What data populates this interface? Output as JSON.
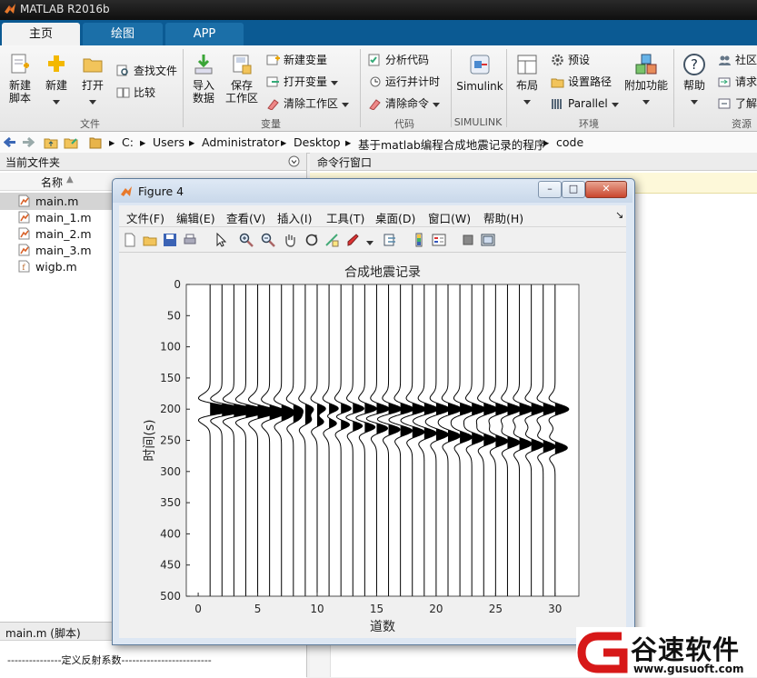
{
  "app": {
    "title": "MATLAB R2016b"
  },
  "tabs": [
    {
      "label": "主页",
      "active": true
    },
    {
      "label": "绘图",
      "active": false
    },
    {
      "label": "APP",
      "active": false
    }
  ],
  "ribbon": {
    "file": {
      "group": "文件",
      "new_script": [
        "新建",
        "脚本"
      ],
      "new": "新建",
      "open": "打开",
      "find_files": "查找文件",
      "compare": "比较"
    },
    "variable": {
      "group": "变量",
      "import": [
        "导入",
        "数据"
      ],
      "save_workspace": [
        "保存",
        "工作区"
      ],
      "new_variable": "新建变量",
      "open_variable": "打开变量",
      "clear_workspace": "清除工作区"
    },
    "code": {
      "group": "代码",
      "analyze": "分析代码",
      "run_time": "运行并计时",
      "clear_commands": "清除命令"
    },
    "simulink": {
      "group": "SIMULINK",
      "label": "Simulink"
    },
    "environment": {
      "group": "环境",
      "layout": "布局",
      "preferences": "预设",
      "set_path": "设置路径",
      "parallel": "Parallel",
      "addons": "附加功能"
    },
    "resources": {
      "group": "资源",
      "help": "帮助",
      "community": "社区",
      "request_support": "请求",
      "learn": "了解"
    }
  },
  "address": {
    "path": [
      "C:",
      "Users",
      "Administrator",
      "Desktop",
      "基于matlab编程合成地震记录的程序",
      "code"
    ]
  },
  "current_folder": {
    "title": "当前文件夹",
    "column": "名称",
    "files": [
      "main.m",
      "main_1.m",
      "main_2.m",
      "main_3.m",
      "wigb.m"
    ],
    "selected": "main.m"
  },
  "details": {
    "title": "main.m  (脚本)",
    "preview": "---------------定义反射系数-------------------------"
  },
  "command_window": {
    "title": "命令行窗口"
  },
  "figure": {
    "title": "Figure 4",
    "menu": [
      "文件(F)",
      "编辑(E)",
      "查看(V)",
      "插入(I)",
      "工具(T)",
      "桌面(D)",
      "窗口(W)",
      "帮助(H)"
    ],
    "window_buttons": {
      "minimize": "–",
      "maximize": "□",
      "close": "✕"
    }
  },
  "chart_data": {
    "type": "line",
    "title": "合成地震记录",
    "xlabel": "道数",
    "ylabel": "时间(s)",
    "xlim": [
      -1,
      32
    ],
    "ylim": [
      500,
      0
    ],
    "y_reversed": true,
    "xticks": [
      0,
      5,
      10,
      15,
      20,
      25,
      30
    ],
    "yticks": [
      0,
      50,
      100,
      150,
      200,
      250,
      300,
      350,
      400,
      450,
      500
    ],
    "traces": [
      1,
      2,
      3,
      4,
      5,
      6,
      7,
      8,
      9,
      10,
      11,
      12,
      13,
      14,
      15,
      16,
      17,
      18,
      19,
      20,
      21,
      22,
      23,
      24,
      25,
      26,
      27,
      28,
      29,
      30
    ],
    "events": [
      {
        "name": "flat",
        "time_start": 200,
        "time_end": 200
      },
      {
        "name": "dipping",
        "time_start": 200,
        "time_end": 262
      }
    ],
    "grid": false,
    "style": "wiggle-variable-area"
  },
  "watermark": {
    "brand": "谷速软件",
    "url": "www.gusuoft.com"
  }
}
